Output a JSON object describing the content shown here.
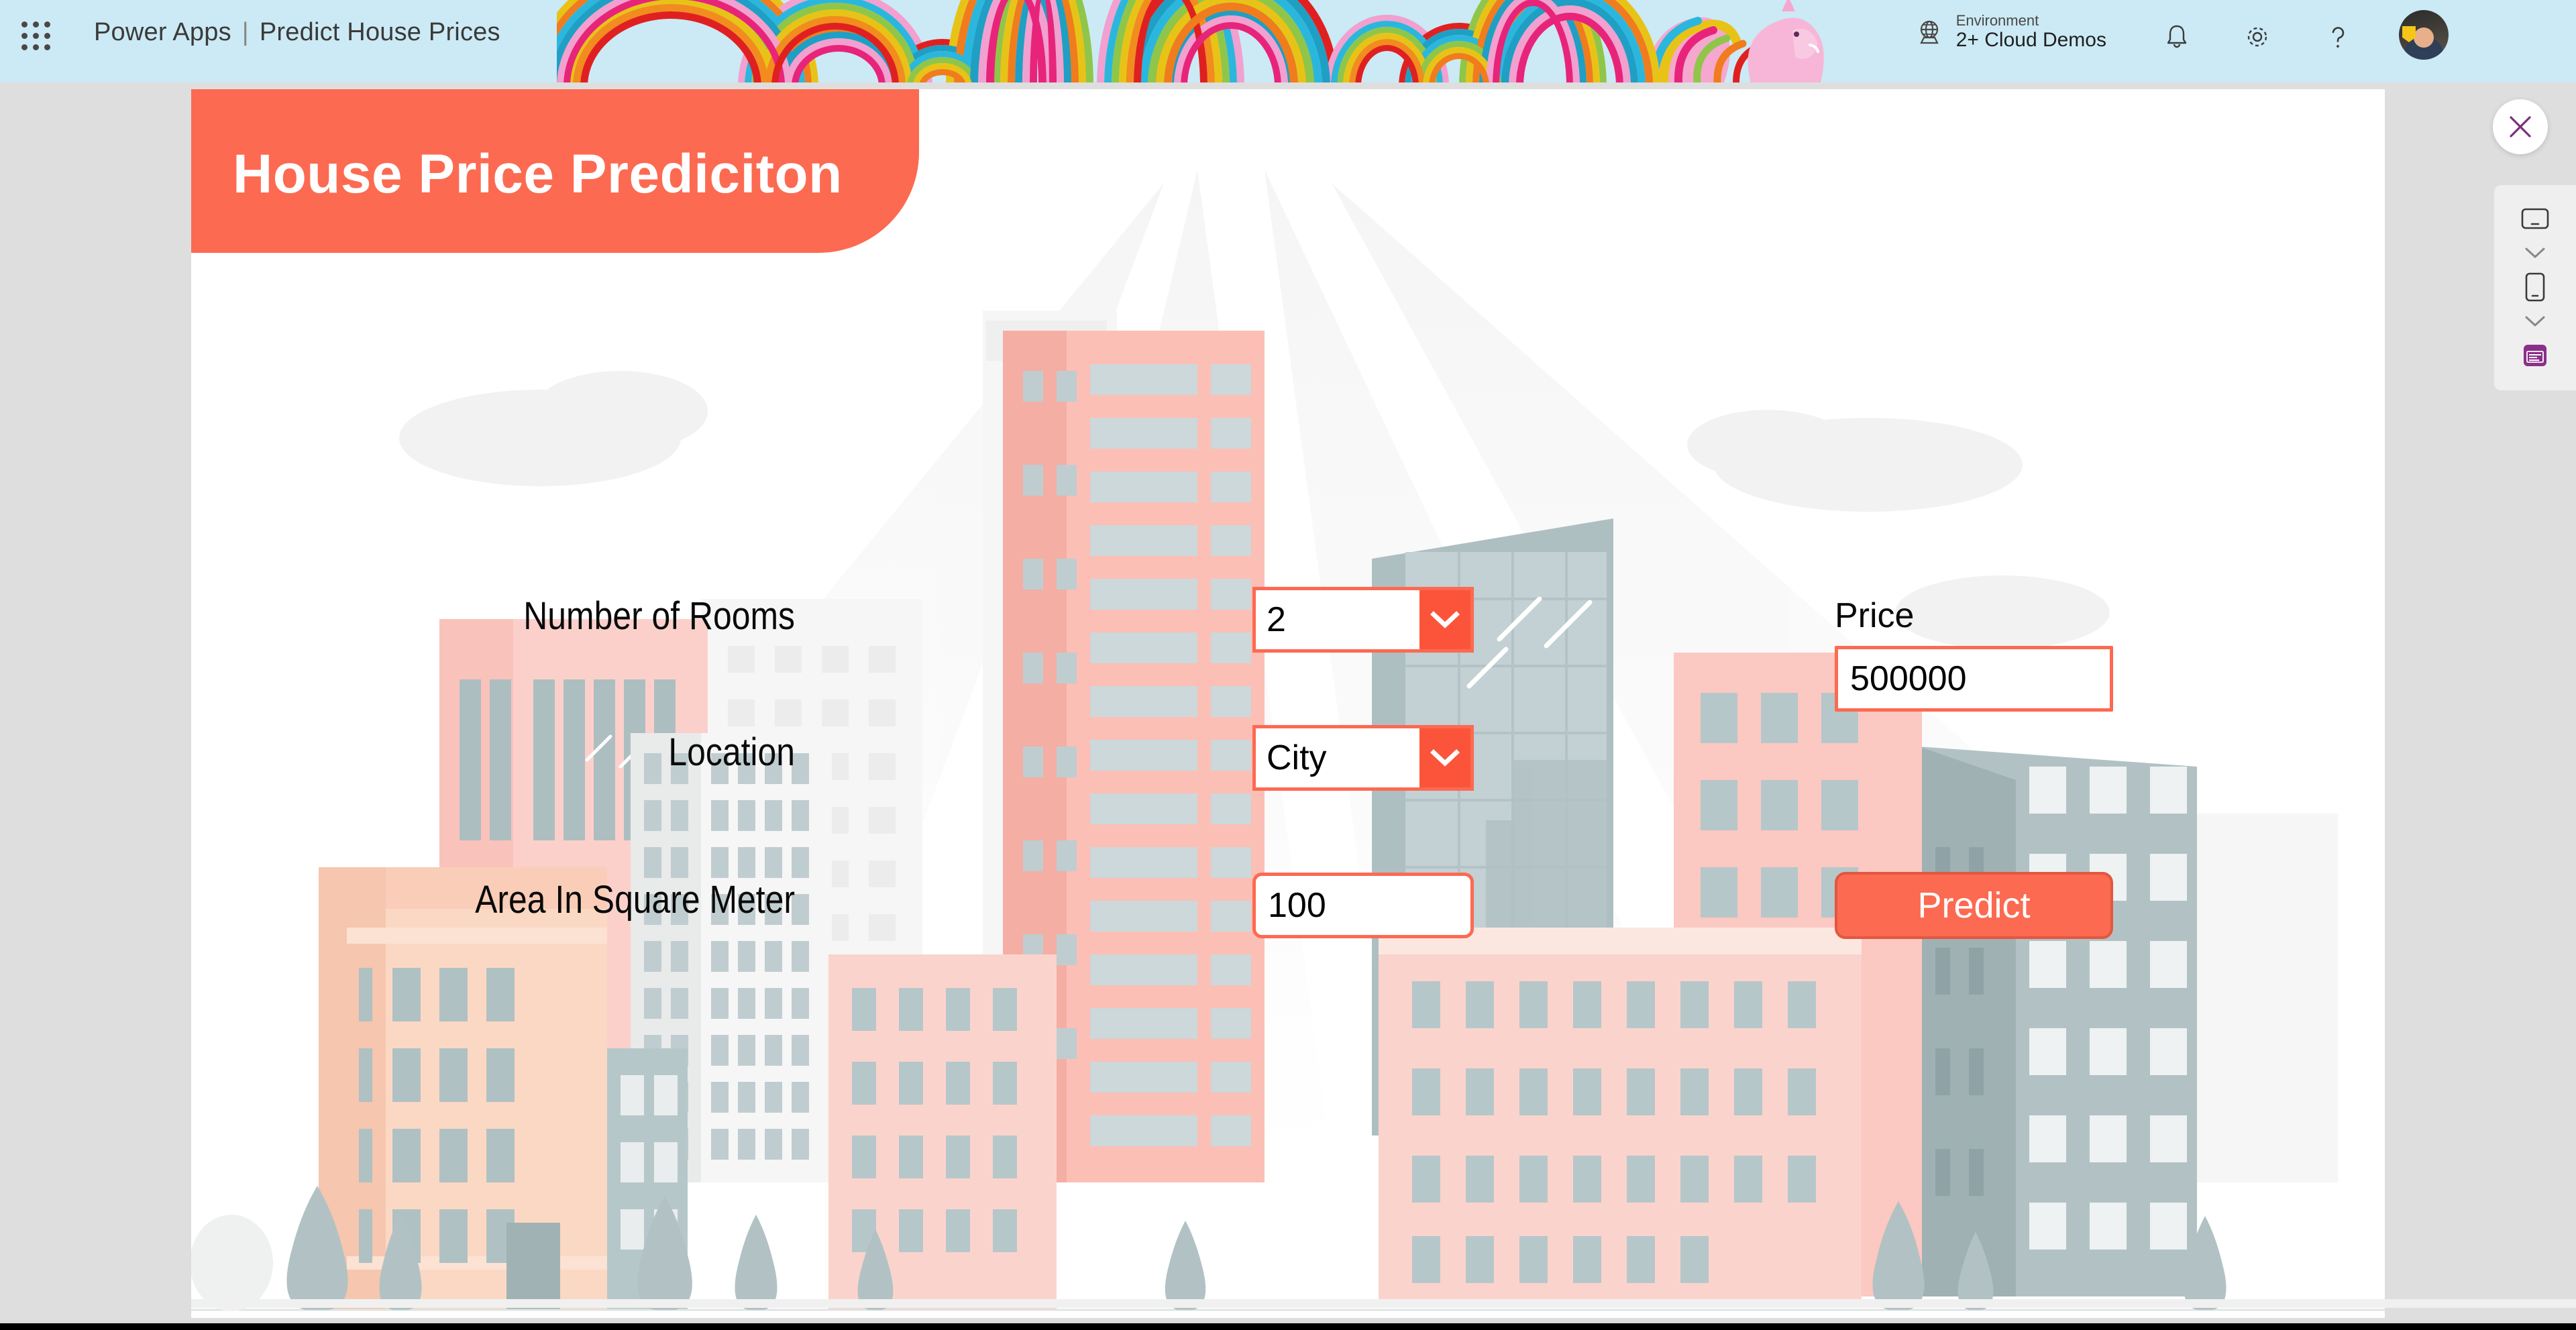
{
  "topbar": {
    "launcher_icon": "app-launcher-grid-icon",
    "brand": "Power Apps",
    "separator": "|",
    "app_name": "Predict House Prices",
    "environment_label": "Environment",
    "environment_value": "2+ Cloud Demos",
    "globe_icon": "globe-icon",
    "bell_icon": "notification-bell-icon",
    "gear_icon": "settings-gear-icon",
    "help_icon": "help-question-icon",
    "avatar_icon": "user-avatar",
    "background_color": "#cbeaf5"
  },
  "app": {
    "title": "House Price Prediciton",
    "title_bg": "#fc6a51",
    "accent": "#fc6a51",
    "fields": [
      {
        "label": "Number of Rooms",
        "value": "2",
        "type": "dropdown"
      },
      {
        "label": "Location",
        "value": "City",
        "type": "dropdown"
      },
      {
        "label": "Area In Square Meter",
        "value": "100",
        "type": "textbox"
      }
    ],
    "price_label": "Price",
    "price_value": "500000",
    "predict_button": "Predict"
  },
  "rail": {
    "close_icon": "close-x-icon",
    "tablet_icon": "tablet-device-icon",
    "tablet_chevron_icon": "chevron-down-icon",
    "phone_icon": "phone-device-icon",
    "phone_chevron_icon": "chevron-down-icon",
    "app_icon": "app-form-icon",
    "accent_color": "#7a2f7a"
  }
}
